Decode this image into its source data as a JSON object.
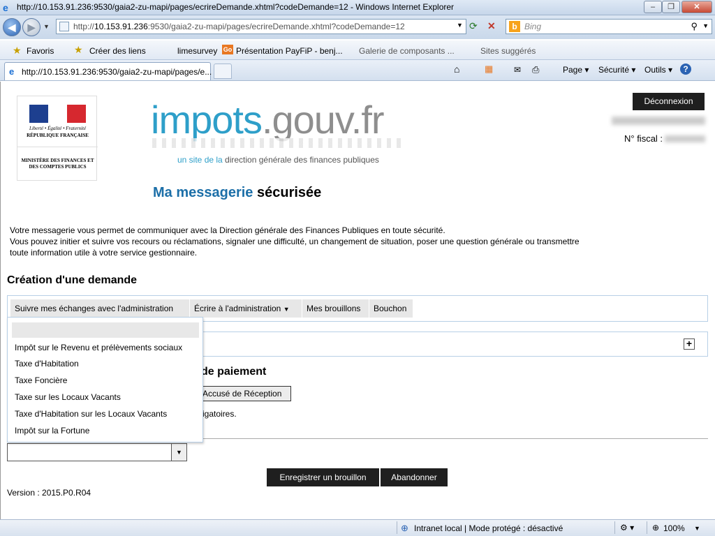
{
  "window": {
    "title": "http://10.153.91.236:9530/gaia2-zu-mapi/pages/ecrireDemande.xhtml?codeDemande=12 - Windows Internet Explorer"
  },
  "address": {
    "url_prefix": "http://",
    "url_host": "10.153.91.236",
    "url_rest": ":9530/gaia2-zu-mapi/pages/ecrireDemande.xhtml?codeDemande=12",
    "search_placeholder": "Bing"
  },
  "favorites": {
    "label": "Favoris",
    "items": [
      "Créer des liens",
      "limesurvey",
      "Présentation PayFiP - benj...",
      "Galerie de composants ...",
      "Sites suggérés"
    ]
  },
  "tab": {
    "title": "http://10.153.91.236:9530/gaia2-zu-mapi/pages/e..."
  },
  "toolbar": {
    "page": "Page",
    "security": "Sécurité",
    "tools": "Outils"
  },
  "header": {
    "brand_main": "impots",
    "brand_rest": ".gouv.fr",
    "brand_sub_pre": "un site de la ",
    "brand_sub": "direction générale des finances publiques",
    "logo_rf_line1": "Liberté • Égalité • Fraternité",
    "logo_rf_line2": "RÉPUBLIQUE FRANÇAISE",
    "logo_ministry": "MINISTÈRE DES FINANCES ET DES COMPTES PUBLICS",
    "logout": "Déconnexion",
    "fiscal_label": "N° fiscal :"
  },
  "page": {
    "title_part1": "Ma messagerie",
    "title_part2": " sécurisée",
    "intro_line1": "Votre messagerie vous permet de communiquer avec la Direction générale des Finances Publiques en toute sécurité.",
    "intro_line2": "Vous pouvez initier et suivre vos recours ou réclamations, signaler une difficulté, un changement de situation, poser une question générale ou transmettre toute information utile à votre service gestionnaire.",
    "section_title": "Création d'une demande",
    "paiement_title": "de paiement",
    "accuse_button": "Accusé de Réception",
    "obligatoires": "igatoires."
  },
  "menu": {
    "items": [
      "Suivre mes échanges avec l'administration",
      "Écrire à l'administration",
      "Mes brouillons",
      "Bouchon"
    ]
  },
  "dropdown": {
    "options": [
      "Impôt sur le Revenu et prélèvements sociaux",
      "Taxe d'Habitation",
      "Taxe Foncière",
      "Taxe sur les Locaux Vacants",
      "Taxe d'Habitation sur les Locaux Vacants",
      "Impôt sur la Fortune"
    ]
  },
  "actions": {
    "save_draft": "Enregistrer un brouillon",
    "abandon": "Abandonner"
  },
  "footer": {
    "version": "Version : 2015.P0.R04"
  },
  "statusbar": {
    "zone": "Intranet local | Mode protégé : désactivé",
    "zoom": "100%"
  },
  "colors": {
    "brand_blue": "#2e9fc9",
    "title_blue": "#1c6fa8",
    "button_dark": "#1f1f1f"
  }
}
